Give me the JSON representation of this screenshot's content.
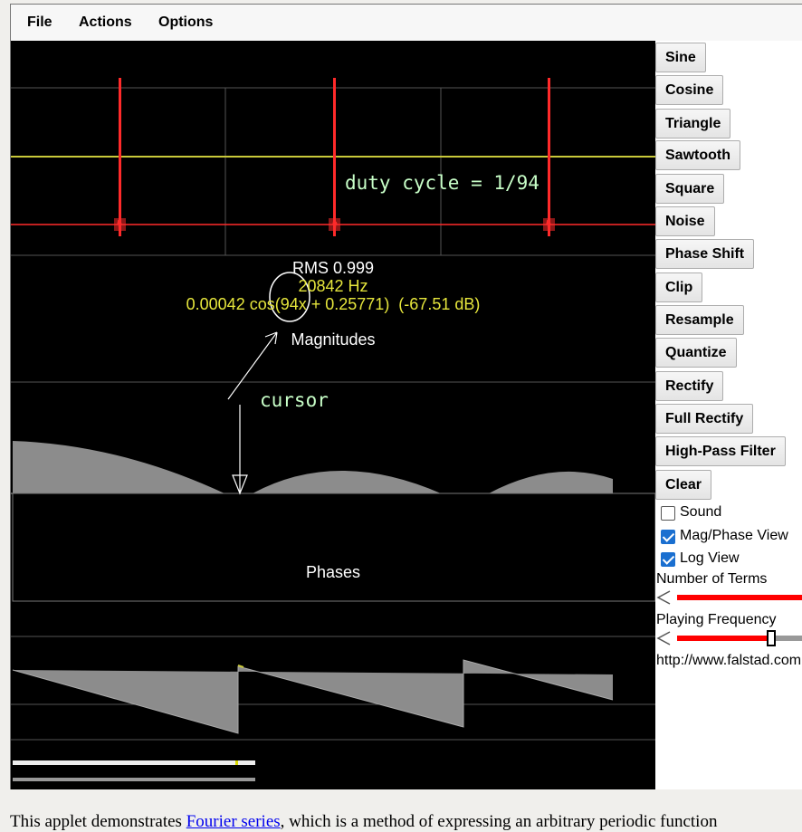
{
  "menu": {
    "file": "File",
    "actions": "Actions",
    "options": "Options"
  },
  "canvas": {
    "annotation_duty": "duty cycle = 1/94",
    "rms": "RMS 0.999",
    "freq": "20842 Hz",
    "term": "0.00042 cos(94x + 0.25771)  (-67.51 dB)",
    "magnitudes_label": "Magnitudes",
    "cursor_label": "cursor",
    "phases_label": "Phases"
  },
  "buttons": [
    "Sine",
    "Cosine",
    "Triangle",
    "Sawtooth",
    "Square",
    "Noise",
    "Phase Shift",
    "Clip",
    "Resample",
    "Quantize",
    "Rectify",
    "Full Rectify",
    "High-Pass Filter",
    "Clear"
  ],
  "checkboxes": [
    {
      "label": "Sound",
      "checked": false
    },
    {
      "label": "Mag/Phase View",
      "checked": true
    },
    {
      "label": "Log View",
      "checked": true
    }
  ],
  "sliders": {
    "terms_label": "Number of Terms",
    "freq_label": "Playing Frequency",
    "url": "http://www.falstad.com"
  },
  "footer": {
    "before": "This applet demonstrates ",
    "link": "Fourier series",
    "after": ", which is a method of expressing an arbitrary periodic function"
  },
  "colors": {
    "wave": "#ff2a2a",
    "axis": "#c9c93a",
    "gray": "#8c8c8c",
    "annot": "#c8ffc8",
    "freq_text": "#e6e63c"
  }
}
